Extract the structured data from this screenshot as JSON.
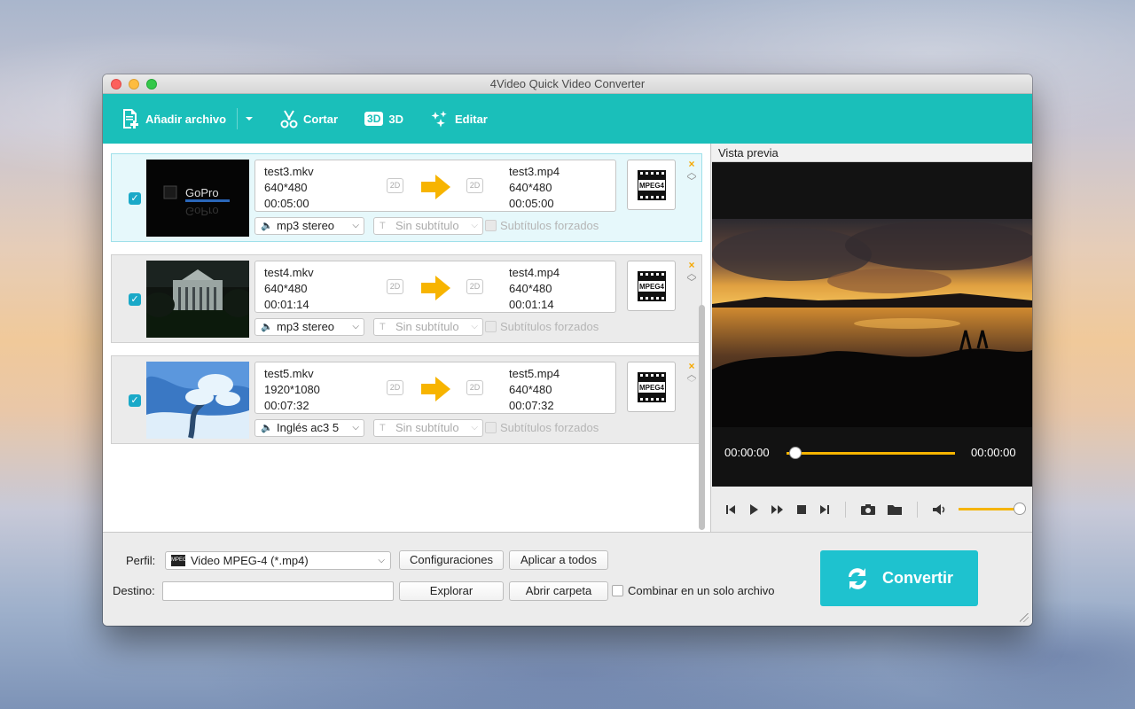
{
  "window": {
    "title": "4Video Quick Video Converter"
  },
  "toolbar": {
    "add_file": "Añadir archivo",
    "cut": "Cortar",
    "three_d_badge": "3D",
    "three_d": "3D",
    "edit": "Editar"
  },
  "items": [
    {
      "src_name": "test3.mkv",
      "src_res": "640*480",
      "src_dur": "00:05:00",
      "dst_name": "test3.mp4",
      "dst_res": "640*480",
      "dst_dur": "00:05:00",
      "tag_in": "2D",
      "tag_out": "2D",
      "format_label": "MPEG4",
      "audio": "mp3 stereo",
      "subtitle": "Sin subtítulo",
      "forced": "Subtítulos forzados"
    },
    {
      "src_name": "test4.mkv",
      "src_res": "640*480",
      "src_dur": "00:01:14",
      "dst_name": "test4.mp4",
      "dst_res": "640*480",
      "dst_dur": "00:01:14",
      "tag_in": "2D",
      "tag_out": "2D",
      "format_label": "MPEG4",
      "audio": "mp3 stereo",
      "subtitle": "Sin subtítulo",
      "forced": "Subtítulos forzados"
    },
    {
      "src_name": "test5.mkv",
      "src_res": "1920*1080",
      "src_dur": "00:07:32",
      "dst_name": "test5.mp4",
      "dst_res": "640*480",
      "dst_dur": "00:07:32",
      "tag_in": "2D",
      "tag_out": "2D",
      "format_label": "MPEG4",
      "audio": "Inglés ac3 5",
      "subtitle": "Sin subtítulo",
      "forced": "Subtítulos forzados"
    }
  ],
  "preview": {
    "label": "Vista previa",
    "time_current": "00:00:00",
    "time_total": "00:00:00",
    "progress_fraction": 0.05,
    "volume_fraction": 1.0
  },
  "bottom": {
    "profile_label": "Perfil:",
    "profile_value": "Video MPEG-4 (*.mp4)",
    "profile_icon_text": "MPEG",
    "settings_button": "Configuraciones",
    "apply_all_button": "Aplicar a todos",
    "dest_label": "Destino:",
    "dest_value": "",
    "browse_button": "Explorar",
    "open_folder_button": "Abrir carpeta",
    "combine_label": "Combinar en un solo archivo",
    "convert_button": "Convertir"
  },
  "colors": {
    "toolbar": "#1abfba",
    "accent_orange": "#f5b400",
    "convert": "#1ec2cf"
  }
}
